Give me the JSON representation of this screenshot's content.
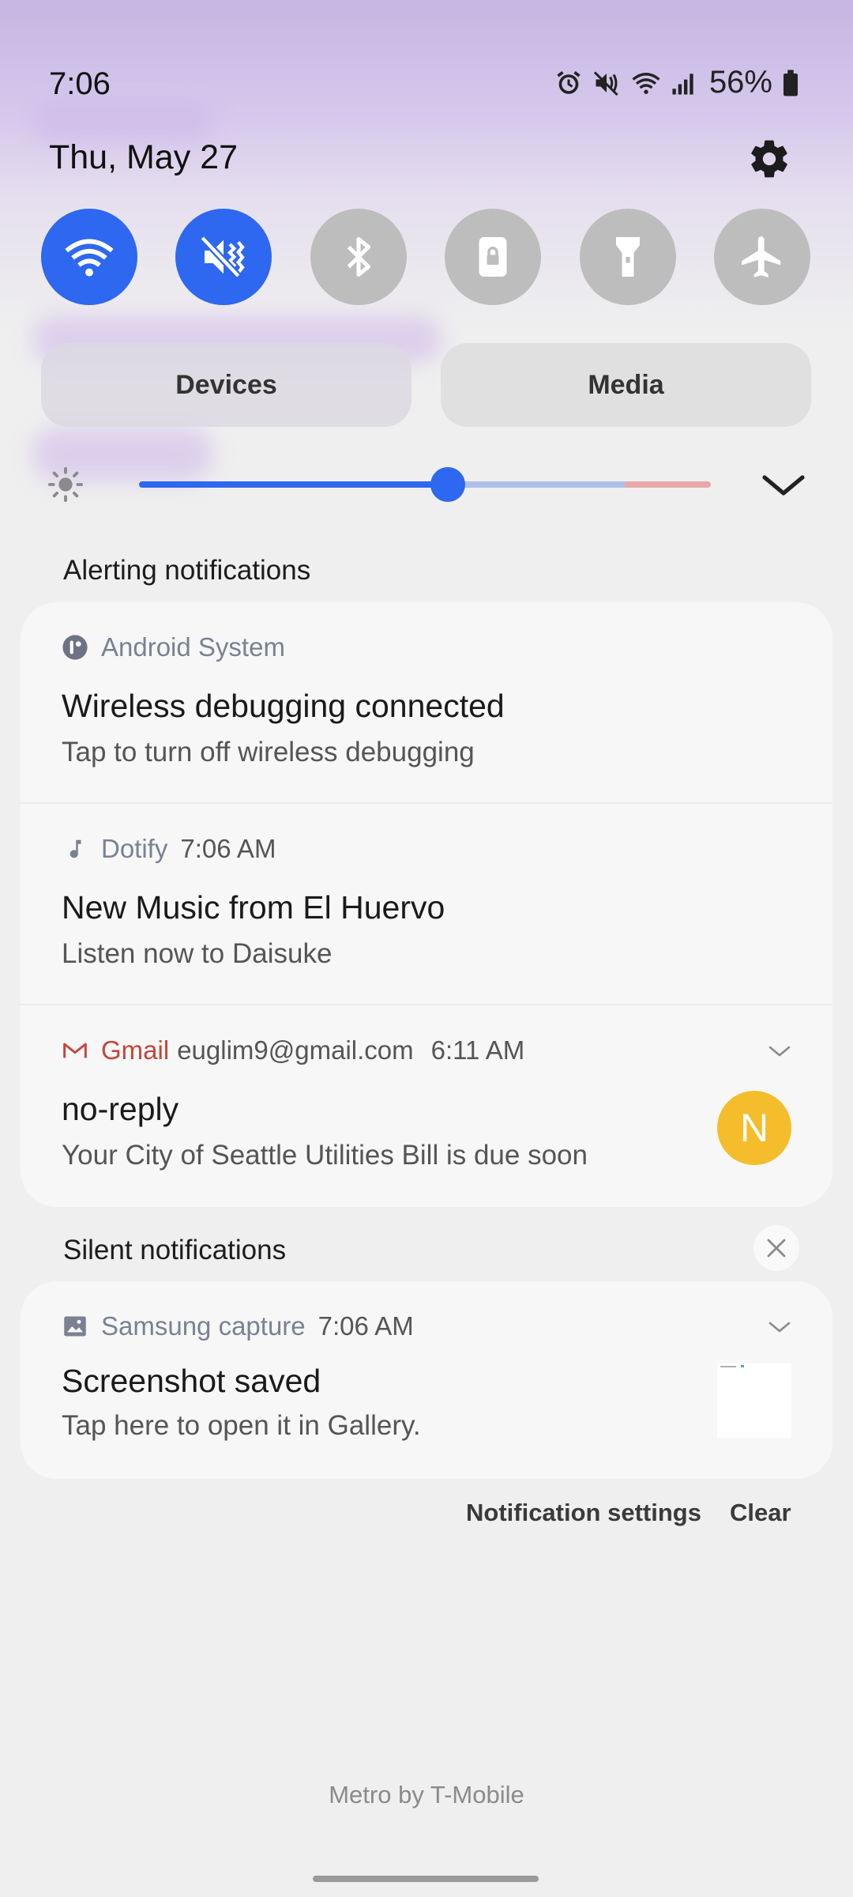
{
  "status_bar": {
    "time": "7:06",
    "battery_pct": "56%",
    "icons": [
      "alarm-icon",
      "mute-icon",
      "wifi-icon",
      "signal-icon",
      "battery-icon"
    ]
  },
  "header": {
    "date": "Thu, May 27",
    "settings_icon": "gear-icon"
  },
  "quick_settings": [
    {
      "icon": "wifi-icon",
      "on": true
    },
    {
      "icon": "mute-icon",
      "on": true
    },
    {
      "icon": "bluetooth-icon",
      "on": false
    },
    {
      "icon": "rotation-lock-icon",
      "on": false
    },
    {
      "icon": "flashlight-icon",
      "on": false
    },
    {
      "icon": "airplane-icon",
      "on": false
    }
  ],
  "pills": {
    "devices": "Devices",
    "media": "Media"
  },
  "brightness": {
    "level": 0.54,
    "accent": "#2e67f0"
  },
  "alerting": {
    "label": "Alerting notifications",
    "items": [
      {
        "app": "Android System",
        "icon": "android-system-icon",
        "title": "Wireless debugging connected",
        "body": "Tap to turn off wireless debugging"
      },
      {
        "app": "Dotify",
        "time": "7:06 AM",
        "icon": "music-note-icon",
        "title": "New Music from El Huervo",
        "body": "Listen now to Daisuke"
      },
      {
        "app": "Gmail",
        "account": "euglim9@gmail.com",
        "time": "6:11 AM",
        "icon": "gmail-icon",
        "title": "no-reply",
        "body": "Your City of Seattle Utilities Bill is due soon",
        "avatar_letter": "N",
        "app_color": "#c5453b",
        "avatar_color": "#f5bd2c"
      }
    ]
  },
  "silent": {
    "label": "Silent notifications",
    "items": [
      {
        "app": "Samsung capture",
        "time": "7:06 AM",
        "icon": "image-icon",
        "title": "Screenshot saved",
        "body": "Tap here to open it in Gallery."
      }
    ]
  },
  "actions": {
    "settings": "Notification settings",
    "clear": "Clear"
  },
  "carrier": "Metro by T-Mobile"
}
